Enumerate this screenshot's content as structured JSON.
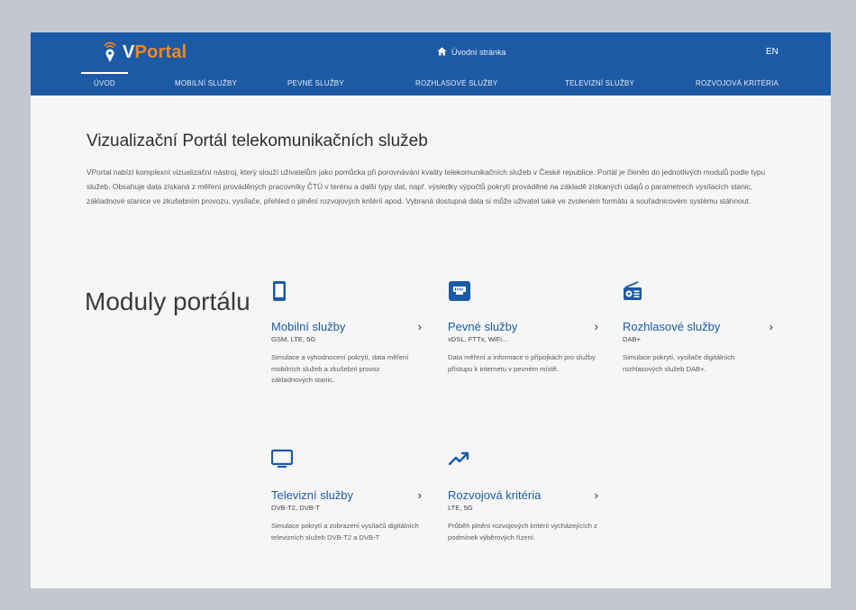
{
  "header": {
    "logo_text_v": "V",
    "logo_text_rest": "Portal",
    "home_label": "Úvodní stránka",
    "lang_label": "EN"
  },
  "nav": {
    "items": [
      {
        "label": "Úvod",
        "active": true
      },
      {
        "label": "Mobilní služby"
      },
      {
        "label": "Pevné služby"
      },
      {
        "label": "Rozhlasové služby"
      },
      {
        "label": "Televizní služby"
      },
      {
        "label": "Rozvojová kritéria"
      }
    ]
  },
  "main": {
    "title": "Vizualizační Portál telekomunikačních služeb",
    "intro": "VPortal nabízí komplexní vizualizační nástroj, který slouží uživatelům jako pomůcka při porovnávání kvality telekomunikačních služeb v České republice. Portál je členěn do jednotlivých modulů podle typu služeb. Obsahuje data získaná z měření prováděných pracovníky ČTÚ v terénu a další typy dat, např. výsledky výpočtů pokrytí prováděné na základě získaných údajů o parametrech vysílacích stanic, základnové stanice ve zkušebním provozu, vysílače, přehled o plnění rozvojových kritérií apod. Vybraná dostupná data si může uživatel také ve zvoleném formátu a souřadnicovém systému stáhnout.",
    "modules_heading": "Moduly portálu"
  },
  "modules": [
    {
      "icon": "smartphone-icon",
      "title": "Mobilní služby",
      "subtitle": "GSM, LTE, 5G",
      "description": "Simulace a vyhodnocení pokrytí, data měření mobilních služeb a zkušební provoz základnových stanic."
    },
    {
      "icon": "ethernet-port-icon",
      "title": "Pevné služby",
      "subtitle": "xDSL, FTTx, WiFi...",
      "description": "Data měření a informace o přípojkách pro služby přístupu k internetu v pevném místě."
    },
    {
      "icon": "radio-icon",
      "title": "Rozhlasové služby",
      "subtitle": "DAB+",
      "description": "Simulace pokrytí, vysílače digitálních rozhlasových služeb DAB+."
    },
    {
      "icon": "television-icon",
      "title": "Televizní služby",
      "subtitle": "DVB-T2, DVB-T",
      "description": "Simulace pokrytí a zobrazení vysílačů digitálních televizních služeb DVB-T2 a DVB-T"
    },
    {
      "icon": "trending-up-icon",
      "title": "Rozvojová kritéria",
      "subtitle": "LTE, 5G",
      "description": "Průběh plnění rozvojových kritérií vycházejících z podmínek výběrových řízení."
    }
  ],
  "colors": {
    "header_bg": "#1c5aa6",
    "accent_orange": "#f08a1e",
    "link_blue": "#1c5aa6"
  }
}
